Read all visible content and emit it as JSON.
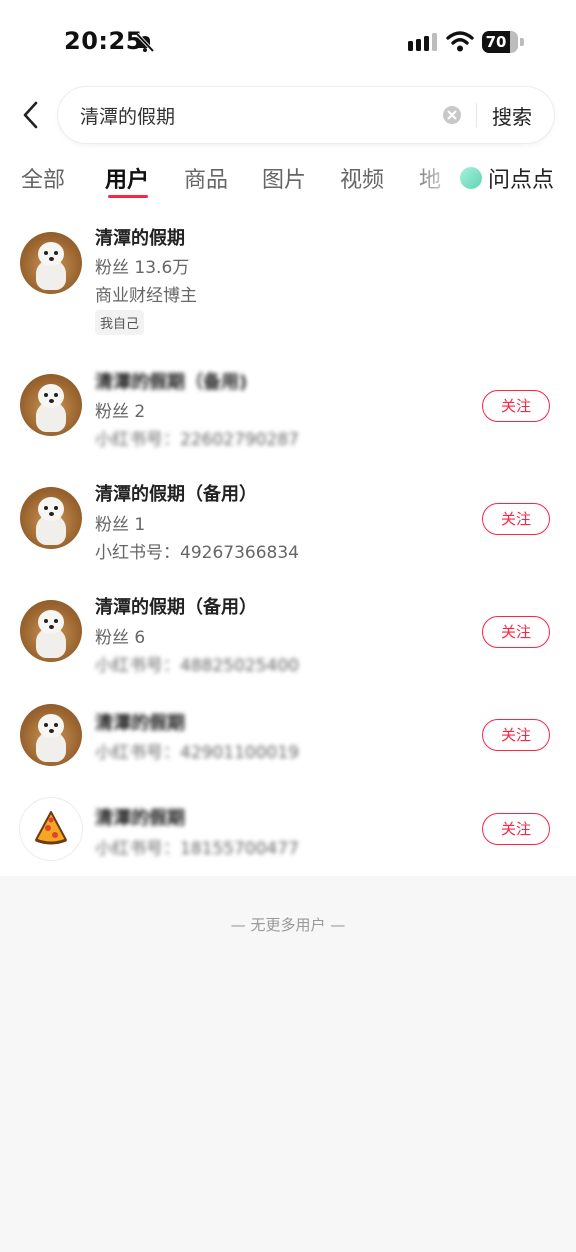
{
  "status_bar": {
    "time": "20:25",
    "battery": "70",
    "icons": [
      "bell-slash-icon",
      "signal-icon",
      "wifi-icon",
      "battery-icon"
    ]
  },
  "search": {
    "back_icon": "chevron-left-icon",
    "query": "清潭的假期",
    "clear_icon": "clear-icon",
    "submit_label": "搜索"
  },
  "tabs": [
    {
      "label": "全部"
    },
    {
      "label": "用户",
      "active": true
    },
    {
      "label": "商品"
    },
    {
      "label": "图片"
    },
    {
      "label": "视频"
    },
    {
      "label": "地"
    }
  ],
  "wendian": {
    "label": "问点点",
    "icon": "wendian-icon"
  },
  "users": [
    {
      "name": "清潭的假期",
      "line1": "粉丝 13.6万",
      "line2": "商业财经博主",
      "tag": "我自己",
      "avatar": "dog-avatar"
    },
    {
      "name": "清潭的假期（备用)",
      "line1": "粉丝 2",
      "line2": "小红书号：22602790287",
      "follow": "关注",
      "avatar": "dog-avatar"
    },
    {
      "name": "清潭的假期（备用）",
      "line1": "粉丝 1",
      "line2": "小红书号：49267366834",
      "follow": "关注",
      "avatar": "dog-avatar"
    },
    {
      "name": "清潭的假期（备用）",
      "line1": "粉丝 6",
      "line2": "小红书号：48825025400",
      "follow": "关注",
      "avatar": "dog-avatar"
    },
    {
      "name": "清潭的假期",
      "line1": "小红书号：42901100019",
      "follow": "关注",
      "avatar": "dog-avatar"
    },
    {
      "name": "清潭的假期",
      "line1": "小红书号：18155700477",
      "follow": "关注",
      "avatar": "pizza-avatar"
    }
  ],
  "footer": {
    "no_more": "— 无更多用户 —"
  },
  "colors": {
    "accent": "#ff2442",
    "background": "#f7f7f7"
  }
}
